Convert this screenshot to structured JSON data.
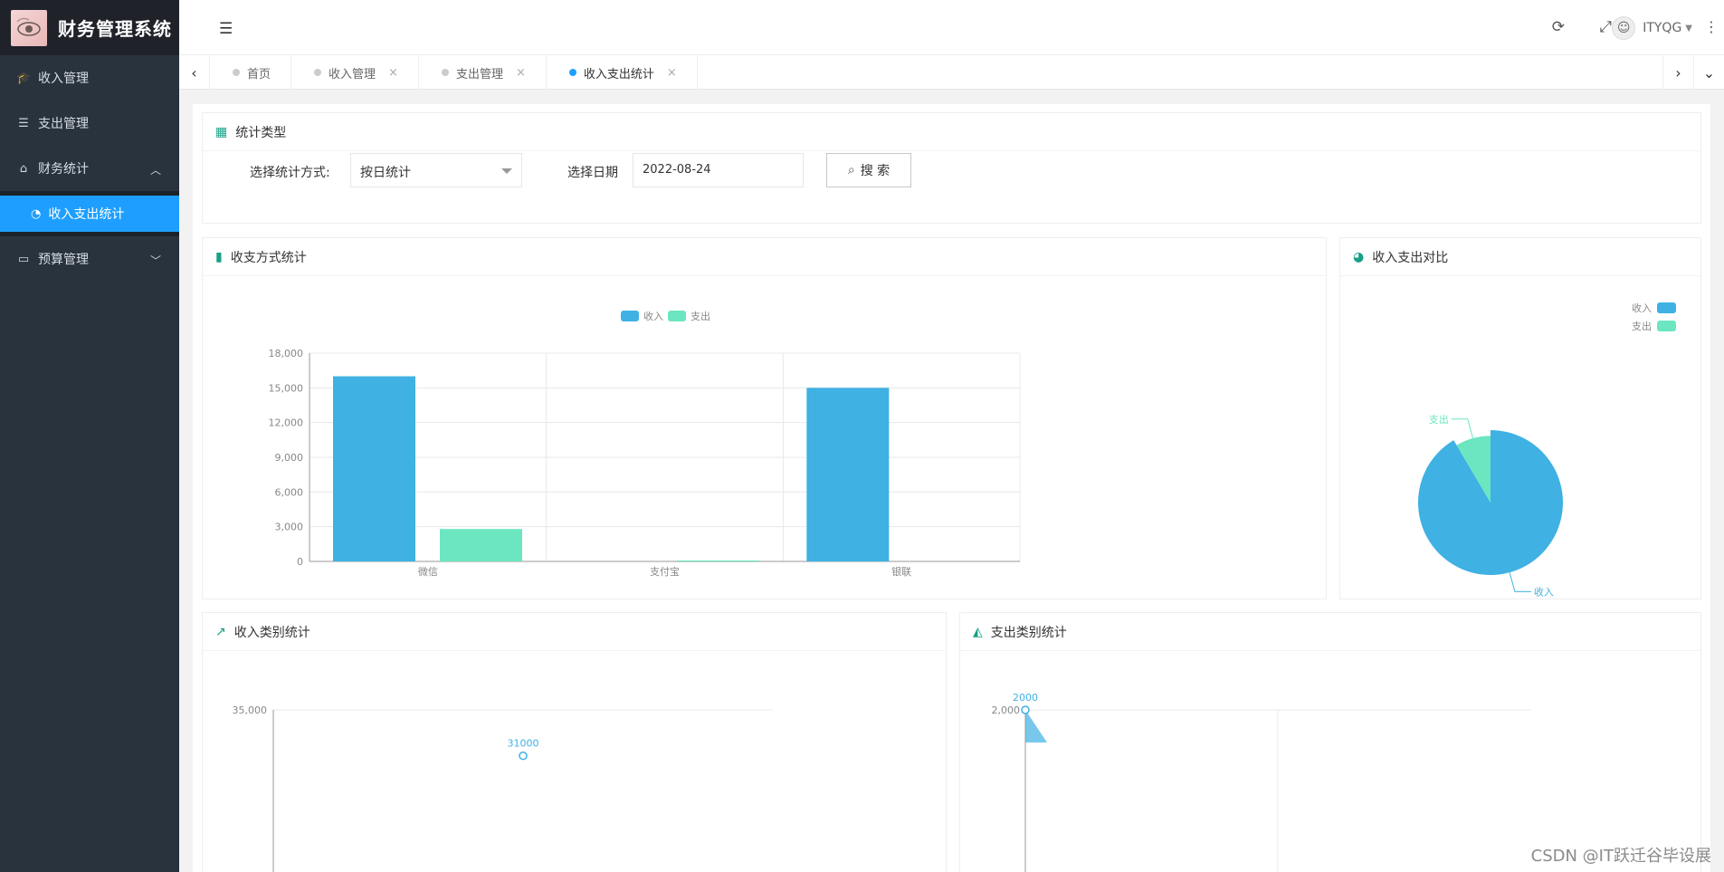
{
  "app": {
    "title": "财务管理系统"
  },
  "sidebar": {
    "items": [
      {
        "label": "收入管理",
        "icon": "graduation-cap-icon"
      },
      {
        "label": "支出管理",
        "icon": "server-icon"
      },
      {
        "label": "财务统计",
        "icon": "home-icon",
        "expanded": true
      },
      {
        "label": "预算管理",
        "icon": "window-icon",
        "expanded": false
      }
    ],
    "sub_item": {
      "label": "收入支出统计",
      "icon": "dashboard-icon"
    }
  },
  "header": {
    "user": "ITYQG"
  },
  "tabs": [
    {
      "label": "首页",
      "closable": false,
      "active": false
    },
    {
      "label": "收入管理",
      "closable": true,
      "active": false
    },
    {
      "label": "支出管理",
      "closable": true,
      "active": false
    },
    {
      "label": "收入支出统计",
      "closable": true,
      "active": true
    }
  ],
  "filter": {
    "title": "统计类型",
    "method_label": "选择统计方式:",
    "method_value": "按日统计",
    "date_label": "选择日期",
    "date_value": "2022-08-24",
    "search_label": "搜 索"
  },
  "panels": {
    "payment": "收支方式统计",
    "compare": "收入支出对比",
    "income_cat": "收入类别统计",
    "expense_cat": "支出类别统计"
  },
  "colors": {
    "income": "#3fb1e3",
    "expense": "#6be6c1",
    "accent": "#1e9fff",
    "sidebar": "#28333e"
  },
  "chart_data": [
    {
      "type": "bar",
      "categories": [
        "微信",
        "支付宝",
        "银联"
      ],
      "series": [
        {
          "name": "收入",
          "values": [
            16000,
            0,
            15000
          ]
        },
        {
          "name": "支出",
          "values": [
            2800,
            80,
            0
          ]
        }
      ],
      "ylim": [
        0,
        18000
      ],
      "yticks": [
        "0",
        "3,000",
        "6,000",
        "9,000",
        "12,000",
        "15,000",
        "18,000"
      ],
      "ytick_values": [
        0,
        3000,
        6000,
        9000,
        12000,
        15000,
        18000
      ],
      "legend": "top-center",
      "grid": true
    },
    {
      "type": "pie",
      "slices": [
        {
          "name": "收入",
          "value": 31000
        },
        {
          "name": "支出",
          "value": 2880
        }
      ],
      "legend": "top-right"
    },
    {
      "type": "line",
      "yticks": [
        "35,000"
      ],
      "ytick_values": [
        35000
      ],
      "ylim": [
        0,
        35000
      ],
      "points": [
        {
          "value": 31000,
          "label": "31000"
        }
      ],
      "partial": true
    },
    {
      "type": "area",
      "yticks": [
        "2,000"
      ],
      "ytick_values": [
        2000
      ],
      "ylim": [
        0,
        2000
      ],
      "points": [
        {
          "value": 2000,
          "label": "2000"
        }
      ],
      "partial": true
    }
  ],
  "watermark": "CSDN @IT跃迁谷毕设展"
}
